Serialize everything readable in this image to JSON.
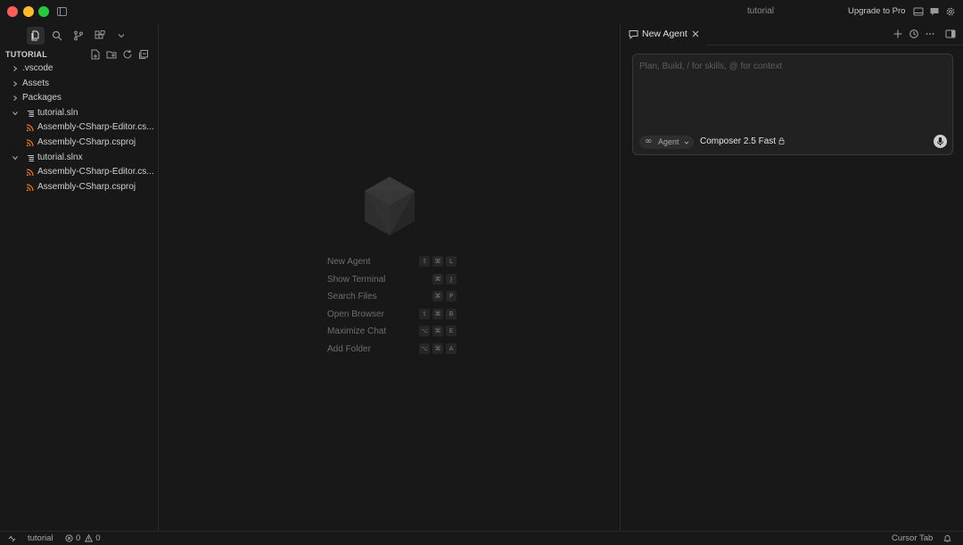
{
  "window": {
    "title": "tutorial",
    "upgrade_label": "Upgrade to Pro"
  },
  "colors": {
    "close": "#ff5f57",
    "minimize": "#febc2e",
    "maximize": "#28c840",
    "background": "#181818",
    "file_icon_orange": "#e8762d"
  },
  "sidebar": {
    "activity_icons": [
      "files-icon",
      "search-icon",
      "source-control-icon",
      "extensions-icon",
      "chevron-down-icon"
    ],
    "explorer_title": "TUTORIAL",
    "explorer_actions": [
      "new-file-icon",
      "new-folder-icon",
      "refresh-icon",
      "collapse-all-icon"
    ],
    "tree": [
      {
        "label": ".vscode",
        "depth": 0,
        "kind": "folder",
        "expanded": false
      },
      {
        "label": "Assets",
        "depth": 0,
        "kind": "folder",
        "expanded": false
      },
      {
        "label": "Packages",
        "depth": 0,
        "kind": "folder",
        "expanded": false
      },
      {
        "label": "tutorial.sln",
        "depth": 0,
        "kind": "solution",
        "expanded": true
      },
      {
        "label": "Assembly-CSharp-Editor.cs...",
        "depth": 1,
        "kind": "csproj"
      },
      {
        "label": "Assembly-CSharp.csproj",
        "depth": 1,
        "kind": "csproj"
      },
      {
        "label": "tutorial.slnx",
        "depth": 0,
        "kind": "solution",
        "expanded": true
      },
      {
        "label": "Assembly-CSharp-Editor.cs...",
        "depth": 1,
        "kind": "csproj"
      },
      {
        "label": "Assembly-CSharp.csproj",
        "depth": 1,
        "kind": "csproj"
      }
    ]
  },
  "editor": {
    "shortcuts": [
      {
        "label": "New Agent",
        "keys": [
          "⇧",
          "⌘",
          "L"
        ]
      },
      {
        "label": "Show Terminal",
        "keys": [
          "⌘",
          "J"
        ]
      },
      {
        "label": "Search Files",
        "keys": [
          "⌘",
          "P"
        ]
      },
      {
        "label": "Open Browser",
        "keys": [
          "⇧",
          "⌘",
          "B"
        ]
      },
      {
        "label": "Maximize Chat",
        "keys": [
          "⌥",
          "⌘",
          "E"
        ]
      },
      {
        "label": "Add Folder",
        "keys": [
          "⌥",
          "⌘",
          "A"
        ]
      }
    ]
  },
  "agent": {
    "tab_label": "New Agent",
    "placeholder": "Plan, Build, / for skills, @ for context",
    "input_value": "",
    "mode_label": "Agent",
    "model_label": "Composer 2.5 Fast"
  },
  "statusbar": {
    "workspace": "tutorial",
    "errors": "0",
    "warnings": "0",
    "right_label": "Cursor Tab"
  }
}
